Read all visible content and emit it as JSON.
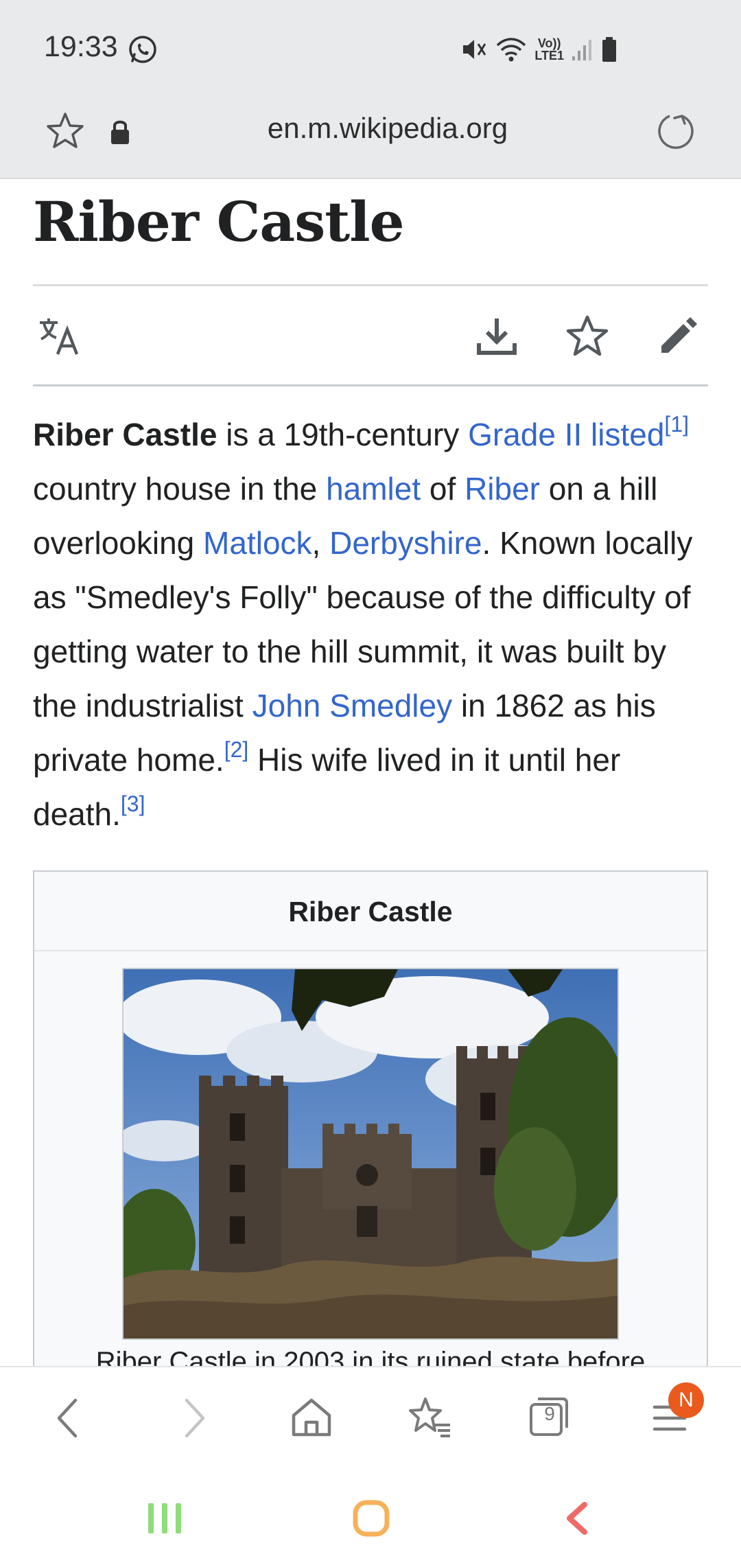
{
  "status_bar": {
    "time": "19:33",
    "icons": [
      "whatsapp-icon",
      "mute-icon",
      "wifi-icon",
      "volte-icon",
      "signal-icon",
      "battery-icon"
    ],
    "volte_label_1": "Vo))",
    "volte_label_2": "LTE1"
  },
  "url_bar": {
    "url": "en.m.wikipedia.org",
    "icons": [
      "bookmark-star-icon",
      "lock-icon",
      "reload-icon"
    ]
  },
  "article": {
    "title": "Riber Castle",
    "toolbar_icons": [
      "translate-icon",
      "download-icon",
      "watch-star-icon",
      "edit-pencil-icon"
    ],
    "intro": {
      "lead_bold": "Riber Castle",
      "t1": " is a 19th-century ",
      "link_grade": "Grade II listed",
      "ref1": "[1]",
      "t2": " country house in the ",
      "link_hamlet": "hamlet",
      "t3": " of ",
      "link_riber": "Riber",
      "t4": " on a hill overlooking ",
      "link_matlock": "Matlock",
      "t5": ", ",
      "link_derbyshire": "Derbyshire",
      "t6": ". Known locally as \"Smedley's Folly\" because of the difficulty of getting water to the hill summit, it was built by the industrialist ",
      "link_smedley": "John Smedley",
      "t7": " in 1862 as his private home.",
      "ref2": "[2]",
      "t8": " His wife lived in it until her death.",
      "ref3": "[3]"
    },
    "infobox": {
      "title": "Riber Castle",
      "caption": "Riber Castle in 2003 in its ruined state before"
    }
  },
  "browser_toolbar": {
    "icons": [
      "back-icon",
      "forward-icon",
      "home-icon",
      "bookmarks-icon",
      "tabs-icon",
      "menu-icon"
    ],
    "tabs_count": "9",
    "menu_badge": "N"
  },
  "system_nav": {
    "icons": [
      "recents-icon",
      "home-icon",
      "back-icon"
    ],
    "colors": {
      "recents": "#8fdc7a",
      "home": "#f6b15a",
      "back": "#ef6a66"
    }
  },
  "colors": {
    "link": "#3366cc",
    "badge": "#ea5a1c"
  }
}
